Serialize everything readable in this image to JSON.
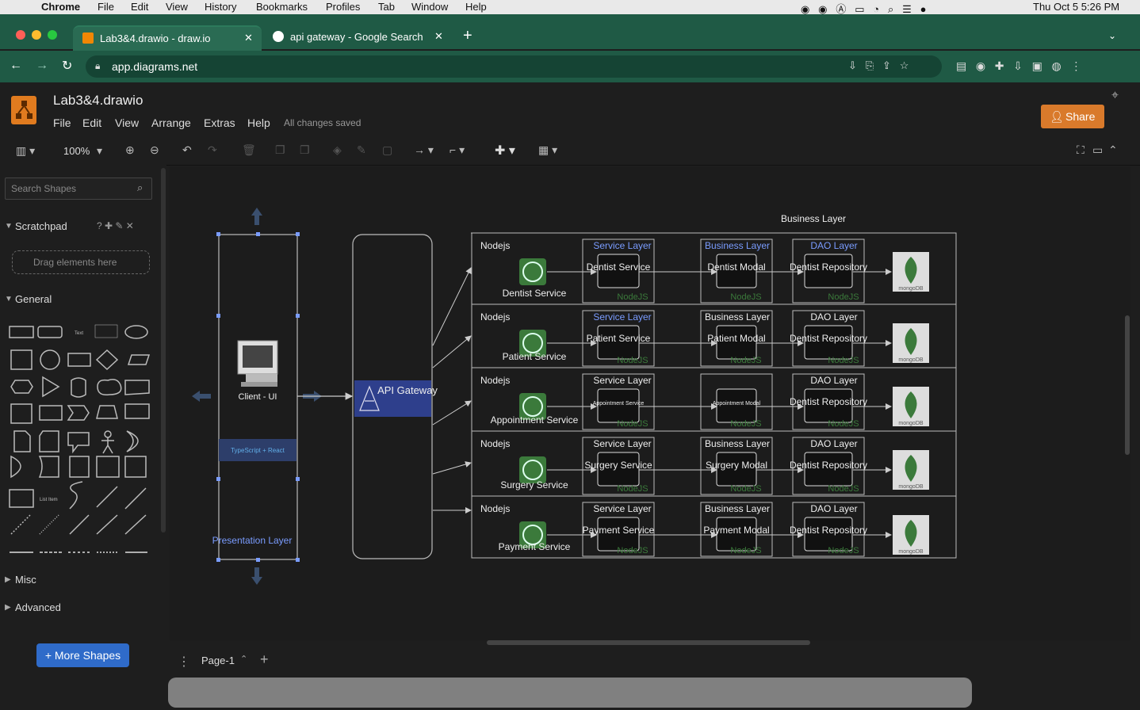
{
  "menubar": {
    "apple": "",
    "app": "Chrome",
    "items": [
      "File",
      "Edit",
      "View",
      "History",
      "Bookmarks",
      "Profiles",
      "Tab",
      "Window",
      "Help"
    ],
    "clock": "Thu Oct 5  5:26 PM"
  },
  "tabs": [
    {
      "title": "Lab3&4.drawio - draw.io"
    },
    {
      "title": "api gateway - Google Search"
    }
  ],
  "address": "app.diagrams.net",
  "drawio": {
    "filename": "Lab3&4.drawio",
    "menu": [
      "File",
      "Edit",
      "View",
      "Arrange",
      "Extras",
      "Help"
    ],
    "status": "All changes saved",
    "share": "Share",
    "zoom": "100%"
  },
  "sidebar": {
    "search_placeholder": "Search Shapes",
    "scratchpad": "Scratchpad",
    "drag_hint": "Drag elements here",
    "general": "General",
    "misc": "Misc",
    "advanced": "Advanced",
    "more_shapes": "+ More Shapes"
  },
  "page": {
    "tab": "Page-1"
  },
  "diagram": {
    "client_label": "Client - UI",
    "presentation_label": "Presentation Layer",
    "logos_label": "TypeScript + React",
    "gateway_label": "API Gateway",
    "top_title": "Business Layer",
    "rows": [
      {
        "runtime": "Nodejs",
        "service": "Dentist Service",
        "layer1": "Service Layer",
        "box1": "Dentist Service",
        "layer2": "Business Layer",
        "box2": "Dentist Modal",
        "layer3": "DAO Layer",
        "box3": "Dentist Repository",
        "tag": "NodeJS",
        "db": "mongoDB"
      },
      {
        "runtime": "Nodejs",
        "service": "Patient Service",
        "layer1": "Service Layer",
        "box1": "Patient Service",
        "layer2": "Business Layer",
        "box2": "Patient Modal",
        "layer3": "DAO Layer",
        "box3": "Dentist Repository",
        "tag": "NodeJS",
        "db": "mongoDB"
      },
      {
        "runtime": "Nodejs",
        "service": "Appointment Service",
        "layer1": "Service Layer",
        "box1": "Appointment Service",
        "layer2": "",
        "box2": "Appointment Modal",
        "layer3": "DAO Layer",
        "box3": "Dentist Repository",
        "tag": "NodeJS",
        "db": "mongoDB"
      },
      {
        "runtime": "Nodejs",
        "service": "Surgery Service",
        "layer1": "Service Layer",
        "box1": "Surgery Service",
        "layer2": "Business Layer",
        "box2": "Surgery Modal",
        "layer3": "DAO Layer",
        "box3": "Dentist Repository",
        "tag": "NodeJS",
        "db": "mongoDB"
      },
      {
        "runtime": "Nodejs",
        "service": "Payment Service",
        "layer1": "Service Layer",
        "box1": "Payment Service",
        "layer2": "Business Layer",
        "box2": "Payment Modal",
        "layer3": "DAO Layer",
        "box3": "Dentist Repository",
        "tag": "NodeJS",
        "db": "mongoDB"
      }
    ]
  },
  "colors": {
    "chrome_green": "#1f5a45",
    "share": "#d97a2b",
    "accent_blue": "#7a9cff",
    "nodejs_green": "#3b7a3b",
    "gateway": "#2e3f8c"
  }
}
